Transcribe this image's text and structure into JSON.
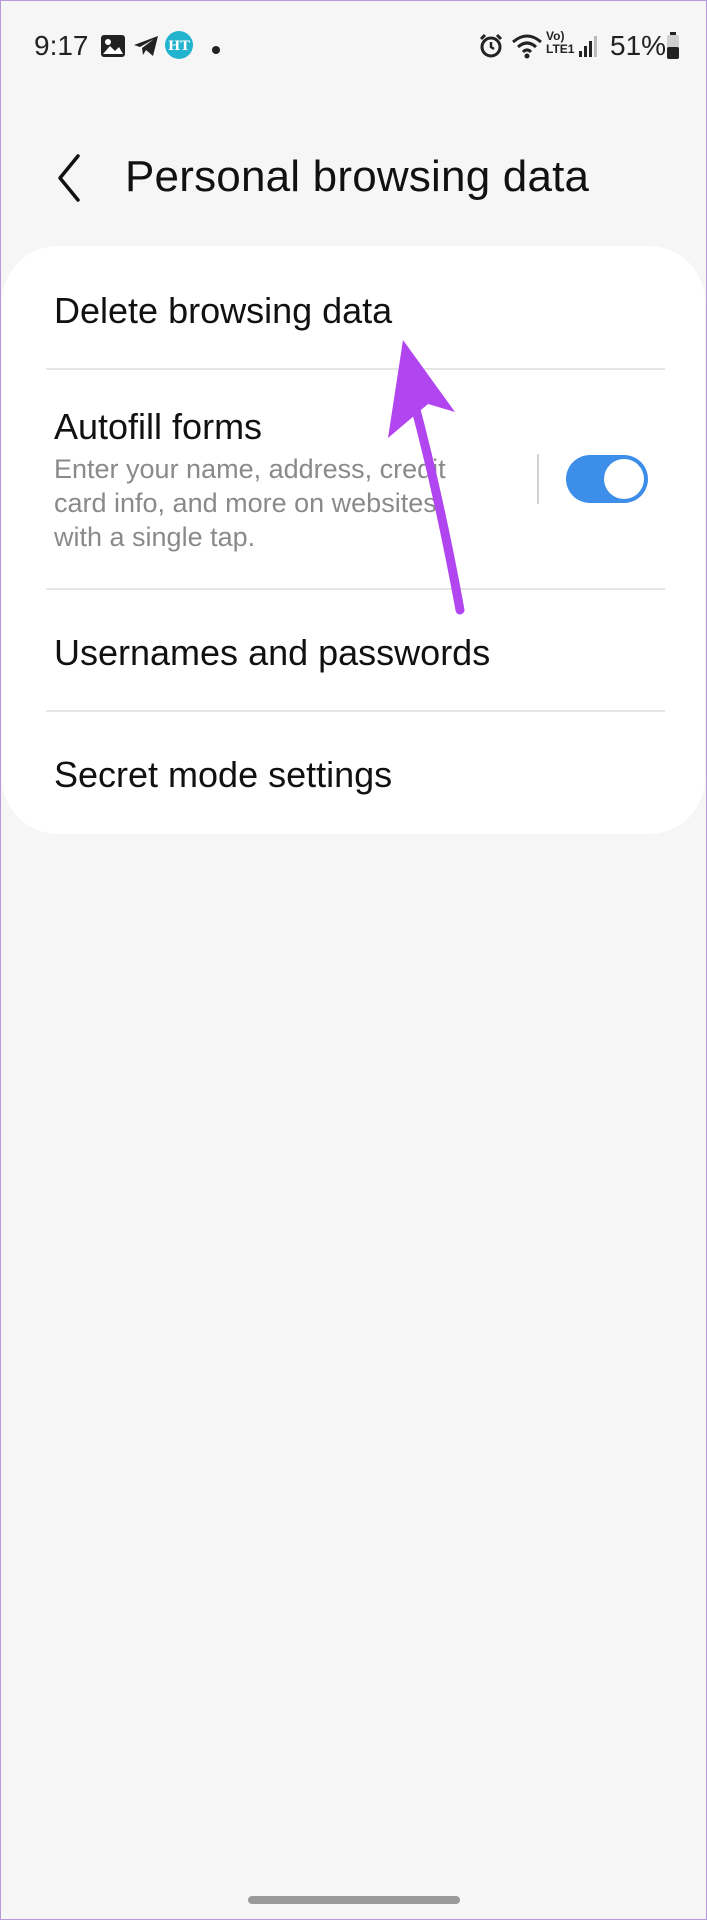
{
  "status_bar": {
    "time": "9:17",
    "network": "Vo)\nLTE1",
    "battery": "51%",
    "icons": [
      "gallery-icon",
      "telegram-icon",
      "ht-app-icon",
      "notification-dot",
      "alarm-icon",
      "wifi-icon",
      "signal-icon",
      "battery-icon"
    ]
  },
  "header": {
    "title": "Personal browsing data",
    "back_icon": "chevron-left-icon"
  },
  "settings": {
    "items": [
      {
        "label": "Delete browsing data"
      },
      {
        "label": "Autofill forms",
        "subtitle": "Enter your name, address, credit card info, and more on websites with a single tap.",
        "toggle_on": true
      },
      {
        "label": "Usernames and passwords"
      },
      {
        "label": "Secret mode settings"
      }
    ]
  },
  "colors": {
    "accent": "#3c8ee8",
    "annotation_arrow": "#b145f0",
    "background": "#f6f6f6"
  }
}
